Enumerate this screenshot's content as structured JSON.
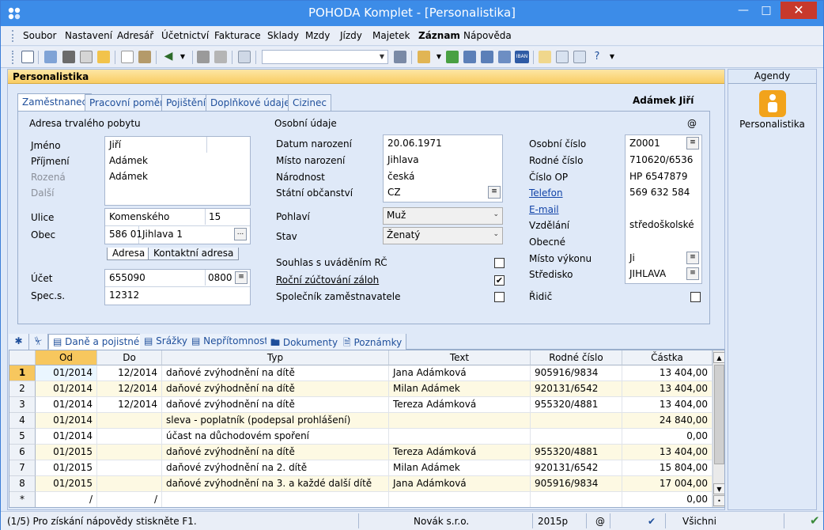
{
  "window": {
    "title": "POHODA Komplet - [Personalistika]"
  },
  "menu": [
    "Soubor",
    "Nastavení",
    "Adresář",
    "Účetnictví",
    "Fakturace",
    "Sklady",
    "Mzdy",
    "Jízdy",
    "Majetek",
    "Záznam",
    "Nápověda"
  ],
  "agenda_title": "Personalistika",
  "tabs": [
    "Zaměstnanec",
    "Pracovní poměr",
    "Pojištění",
    "Doplňkové údaje",
    "Cizinec"
  ],
  "person_name": "Adámek Jiří",
  "address": {
    "section_title": "Adresa trvalého pobytu",
    "labels": {
      "jmeno": "Jméno",
      "prijmeni": "Příjmení",
      "rozena": "Rozená",
      "dalsi": "Další",
      "ulice": "Ulice",
      "obec": "Obec",
      "ucet": "Účet",
      "spec": "Spec.s."
    },
    "jmeno": "Jiří",
    "prijmeni": "Adámek",
    "rozena": "Adámek",
    "ulice": "Komenského",
    "cislo": "15",
    "psc": "586 01",
    "obec": "Jihlava 1",
    "addr_tabs": [
      "Adresa",
      "Kontaktní adresa"
    ],
    "ucet": "655090",
    "kod_banky": "0800",
    "spec": "12312"
  },
  "personal": {
    "section_title": "Osobní údaje",
    "at_sign": "@",
    "labels": {
      "datum": "Datum narození",
      "misto": "Místo narození",
      "narodnost": "Národnost",
      "obcanstvi": "Státní občanství",
      "pohlavi": "Pohlaví",
      "stav": "Stav",
      "souhlas": "Souhlas s uváděním RČ",
      "zuctovani": "Roční zúčtování záloh",
      "spolecnik": "Společník zaměstnavatele"
    },
    "datum": "20.06.1971",
    "misto": "Jihlava",
    "narodnost": "česká",
    "obcanstvi": "CZ",
    "pohlavi": "Muž",
    "stav": "Ženatý",
    "souhlas_checked": false,
    "zuctovani_checked": true,
    "spolecnik_checked": false
  },
  "ids": {
    "labels": {
      "osobni": "Osobní číslo",
      "rodne": "Rodné číslo",
      "op": "Číslo OP",
      "telefon": "Telefon",
      "email": "E-mail",
      "vzdelani": "Vzdělání",
      "obecne": "Obecné",
      "misto_vykonu": "Místo výkonu",
      "stredisko": "Středisko",
      "ridic": "Řidič"
    },
    "osobni": "Z0001",
    "rodne": "710620/6536",
    "op": "HP 6547879",
    "telefon": "569 632 584",
    "email": "",
    "vzdelani": "středoškolské",
    "obecne": "",
    "misto_vykonu": "Ji",
    "stredisko": "JIHLAVA",
    "ridic_checked": false
  },
  "bottom_tabs": [
    "Daně a pojistné",
    "Srážky",
    "Nepřítomnost",
    "Dokumenty",
    "Poznámky"
  ],
  "table": {
    "columns": [
      "Od",
      "Do",
      "Typ",
      "Text",
      "Rodné číslo",
      "Částka"
    ],
    "rows": [
      {
        "n": "1",
        "od": "01/2014",
        "do": "12/2014",
        "typ": "daňové zvýhodnění na dítě",
        "text": "Jana Adámková",
        "rc": "905916/9834",
        "castka": "13 404,00"
      },
      {
        "n": "2",
        "od": "01/2014",
        "do": "12/2014",
        "typ": "daňové zvýhodnění na dítě",
        "text": "Milan Adámek",
        "rc": "920131/6542",
        "castka": "13 404,00"
      },
      {
        "n": "3",
        "od": "01/2014",
        "do": "12/2014",
        "typ": "daňové zvýhodnění na dítě",
        "text": "Tereza Adámková",
        "rc": "955320/4881",
        "castka": "13 404,00"
      },
      {
        "n": "4",
        "od": "01/2014",
        "do": "",
        "typ": "sleva - poplatník (podepsal prohlášení)",
        "text": "",
        "rc": "",
        "castka": "24 840,00"
      },
      {
        "n": "5",
        "od": "01/2014",
        "do": "",
        "typ": "účast na důchodovém spoření",
        "text": "",
        "rc": "",
        "castka": "0,00"
      },
      {
        "n": "6",
        "od": "01/2015",
        "do": "",
        "typ": "daňové zvýhodnění na dítě",
        "text": "Tereza Adámková",
        "rc": "955320/4881",
        "castka": "13 404,00"
      },
      {
        "n": "7",
        "od": "01/2015",
        "do": "",
        "typ": "daňové zvýhodnění na 2. dítě",
        "text": "Milan Adámek",
        "rc": "920131/6542",
        "castka": "15 804,00"
      },
      {
        "n": "8",
        "od": "01/2015",
        "do": "",
        "typ": "daňové zvýhodnění na 3. a každé další dítě",
        "text": "Jana Adámková",
        "rc": "905916/9834",
        "castka": "17 004,00"
      },
      {
        "n": "*",
        "od": "/",
        "do": "/",
        "typ": "",
        "text": "",
        "rc": "",
        "castka": "0,00"
      }
    ]
  },
  "agenda_panel": {
    "title": "Agendy",
    "item": "Personalistika"
  },
  "status": {
    "help": "(1/5) Pro získání nápovědy stiskněte F1.",
    "company": "Novák s.r.o.",
    "year": "2015p",
    "at": "@",
    "filter": "Všichni"
  },
  "colors": {
    "title_bar": "#3c8ce8",
    "accent": "#f7c75e",
    "row_alt": "#fdf9e3"
  }
}
